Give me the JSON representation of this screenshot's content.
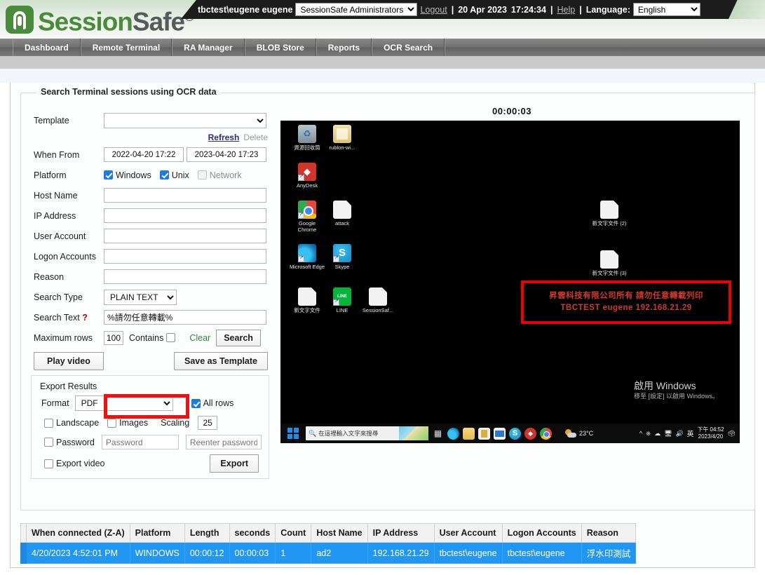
{
  "header": {
    "logo_session": "Session",
    "logo_safe": "Safe",
    "logo_copyright": "©",
    "user": "tbctest\\eugene eugene",
    "role_select": "SessionSafe Administrators",
    "logout": "Logout",
    "sep1": "|",
    "date": "20 Apr 2023",
    "time": "17:24:34",
    "sep2": "|",
    "help": "Help",
    "sep3": "|",
    "language_label": "Language:",
    "language_value": "English"
  },
  "nav": {
    "tabs": [
      {
        "label": "Dashboard"
      },
      {
        "label": "Remote Terminal"
      },
      {
        "label": "RA Manager"
      },
      {
        "label": "BLOB Store"
      },
      {
        "label": "Reports"
      },
      {
        "label": "OCR Search"
      }
    ]
  },
  "search_panel": {
    "legend": "Search Terminal sessions using OCR data",
    "template_label": "Template",
    "template_value": "",
    "refresh_link": "Refresh",
    "delete_link": "Delete",
    "when_from_label": "When From",
    "when_from_value": "2022-04-20 17:22",
    "when_to_value": "2023-04-20 17:23",
    "platform_label": "Platform",
    "platform_windows": "Windows",
    "platform_unix": "Unix",
    "platform_network": "Network",
    "host_name_label": "Host Name",
    "host_name_value": "",
    "ip_address_label": "IP Address",
    "ip_address_value": "",
    "user_account_label": "User Account",
    "user_account_value": "",
    "logon_accounts_label": "Logon Accounts",
    "logon_accounts_value": "",
    "reason_label": "Reason",
    "reason_value": "",
    "search_type_label": "Search Type",
    "search_type_value": "PLAIN TEXT",
    "search_text_label": "Search Text",
    "search_text_help": "?",
    "search_text_value": "%請勿任意轉載%",
    "maximum_rows_label": "Maximum rows",
    "maximum_rows_value": "100",
    "contains_label": "Contains",
    "clear_link": "Clear",
    "search_button": "Search",
    "play_video_button": "Play video",
    "save_template_button": "Save as Template"
  },
  "export_panel": {
    "title": "Export Results",
    "format_label": "Format",
    "format_value": "PDF",
    "all_rows_label": "All rows",
    "landscape_label": "Landscape",
    "images_label": "Images",
    "scaling_label": "Scaling",
    "scaling_value": "25",
    "password_label": "Password",
    "password_placeholder": "Password",
    "reenter_placeholder": "Reenter password",
    "export_video_label": "Export video",
    "export_button": "Export"
  },
  "video": {
    "timecode": "00:00:03",
    "desktop_icons": [
      {
        "label": "資源回收筒",
        "icon": "recycle-bin-icon"
      },
      {
        "label": "rublon-wi...",
        "icon": "folder-icon"
      },
      {
        "label": "AnyDesk",
        "icon": "anydesk-icon"
      },
      {
        "label": "Google Chrome",
        "icon": "chrome-icon"
      },
      {
        "label": "attack",
        "icon": "text-document-icon"
      },
      {
        "label": "Microsoft Edge",
        "icon": "edge-icon"
      },
      {
        "label": "Skype",
        "icon": "skype-icon"
      },
      {
        "label": "新文字文件",
        "icon": "text-document-icon"
      },
      {
        "label": "LINE",
        "icon": "line-icon"
      },
      {
        "label": "SessionSaf...",
        "icon": "text-document-icon"
      },
      {
        "label": "新文字文件 (2)",
        "icon": "text-document-icon"
      },
      {
        "label": "新文字文件 (3)",
        "icon": "text-document-icon"
      }
    ],
    "watermark_line1": "昇雲科技有限公司所有 請勿任意轉載列印",
    "watermark_line2": "TBCTEST eugene 192.168.21.29",
    "activate_title": "啟用 Windows",
    "activate_sub": "移至 [設定] 以啟用 Windows。",
    "taskbar_search_placeholder": "在這裡輸入文字來搜尋",
    "taskbar_temperature": "23°C",
    "taskbar_ime": "英",
    "taskbar_clock_time": "下午 04:52",
    "taskbar_clock_date": "2023/4/20"
  },
  "results_table": {
    "columns": [
      "When connected (Z-A)",
      "Platform",
      "Length",
      "seconds",
      "Count",
      "Host Name",
      "IP Address",
      "User Account",
      "Logon Accounts",
      "Reason"
    ],
    "rows": [
      [
        "4/20/2023 4:52:01 PM",
        "WINDOWS",
        "00:00:12",
        "00:00:03",
        "1",
        "ad2",
        "192.168.21.29",
        "tbctest\\eugene",
        "tbctest\\eugene",
        "浮水印測試"
      ]
    ]
  },
  "colors": {
    "brand_green": "#4a8a3c",
    "nav_grey": "#6f6f6f",
    "row_selected": "#2196f3",
    "highlight_red": "#ee1111",
    "link_blue": "#2b2f7a",
    "clear_green": "#2e8b2e"
  }
}
